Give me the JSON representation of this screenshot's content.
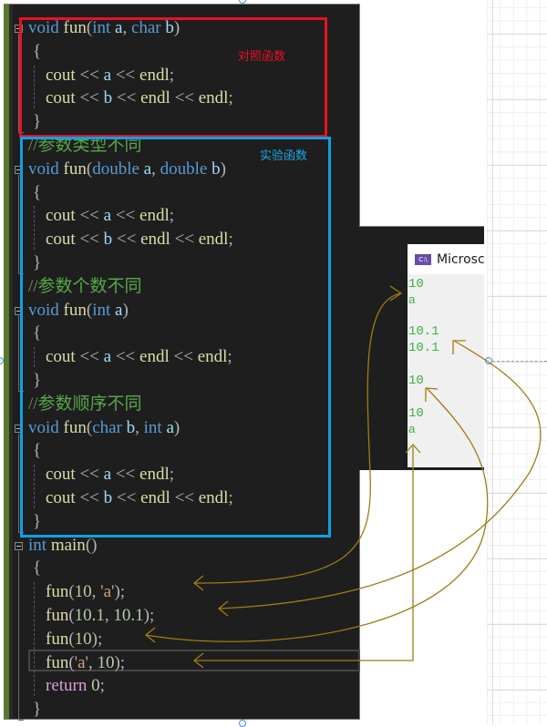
{
  "annotations": {
    "control_label": "对照函数",
    "experiment_label": "实验函数",
    "control_color": "#e81123",
    "experiment_color": "#0fa0e6",
    "arrow_color": "#a07c14"
  },
  "code": {
    "lines": [
      {
        "tokens": [
          [
            "kw",
            "void"
          ],
          [
            "",
            ""
          ],
          [
            "fn",
            "fun"
          ],
          [
            "op",
            "("
          ],
          [
            "kw",
            "int"
          ],
          [
            "id",
            " a"
          ],
          [
            "op",
            ", "
          ],
          [
            "kw",
            "char"
          ],
          [
            "id",
            " b"
          ],
          [
            "op",
            ")"
          ]
        ]
      },
      {
        "tokens": [
          [
            "op",
            "{"
          ]
        ]
      },
      {
        "tokens": [
          [
            "",
            "    "
          ],
          [
            "fn",
            "cout"
          ],
          [
            "op",
            " << "
          ],
          [
            "id",
            "a"
          ],
          [
            "op",
            " << "
          ],
          [
            "fn",
            "endl"
          ],
          [
            "op",
            ";"
          ]
        ]
      },
      {
        "tokens": [
          [
            "",
            "    "
          ],
          [
            "fn",
            "cout"
          ],
          [
            "op",
            " << "
          ],
          [
            "id",
            "b"
          ],
          [
            "op",
            " << "
          ],
          [
            "fn",
            "endl"
          ],
          [
            "op",
            " << "
          ],
          [
            "fn",
            "endl"
          ],
          [
            "op",
            ";"
          ]
        ]
      },
      {
        "tokens": [
          [
            "op",
            "}"
          ]
        ]
      },
      {
        "tokens": [
          [
            "cm",
            "//参数类型不同"
          ]
        ]
      },
      {
        "tokens": [
          [
            "kw",
            "void"
          ],
          [
            "",
            ""
          ],
          [
            "fn",
            "fun"
          ],
          [
            "op",
            "("
          ],
          [
            "kw",
            "double"
          ],
          [
            "id",
            " a"
          ],
          [
            "op",
            ", "
          ],
          [
            "kw",
            "double"
          ],
          [
            "id",
            " b"
          ],
          [
            "op",
            ")"
          ]
        ]
      },
      {
        "tokens": [
          [
            "op",
            "{"
          ]
        ]
      },
      {
        "tokens": [
          [
            "",
            "    "
          ],
          [
            "fn",
            "cout"
          ],
          [
            "op",
            " << "
          ],
          [
            "id",
            "a"
          ],
          [
            "op",
            " << "
          ],
          [
            "fn",
            "endl"
          ],
          [
            "op",
            ";"
          ]
        ]
      },
      {
        "tokens": [
          [
            "",
            "    "
          ],
          [
            "fn",
            "cout"
          ],
          [
            "op",
            " << "
          ],
          [
            "id",
            "b"
          ],
          [
            "op",
            " << "
          ],
          [
            "fn",
            "endl"
          ],
          [
            "op",
            " << "
          ],
          [
            "fn",
            "endl"
          ],
          [
            "op",
            ";"
          ]
        ]
      },
      {
        "tokens": [
          [
            "op",
            "}"
          ]
        ]
      },
      {
        "tokens": [
          [
            "cm",
            "//参数个数不同"
          ]
        ]
      },
      {
        "tokens": [
          [
            "kw",
            "void"
          ],
          [
            "",
            ""
          ],
          [
            "fn",
            "fun"
          ],
          [
            "op",
            "("
          ],
          [
            "kw",
            "int"
          ],
          [
            "id",
            " a"
          ],
          [
            "op",
            ")"
          ]
        ]
      },
      {
        "tokens": [
          [
            "op",
            "{"
          ]
        ]
      },
      {
        "tokens": [
          [
            "",
            "    "
          ],
          [
            "fn",
            "cout"
          ],
          [
            "op",
            " << "
          ],
          [
            "id",
            "a"
          ],
          [
            "op",
            " << "
          ],
          [
            "fn",
            "endl"
          ],
          [
            "op",
            " << "
          ],
          [
            "fn",
            "endl"
          ],
          [
            "op",
            ";"
          ]
        ]
      },
      {
        "tokens": [
          [
            "op",
            "}"
          ]
        ]
      },
      {
        "tokens": [
          [
            "cm",
            "//参数顺序不同"
          ]
        ]
      },
      {
        "tokens": [
          [
            "kw",
            "void"
          ],
          [
            "",
            ""
          ],
          [
            "fn",
            "fun"
          ],
          [
            "op",
            "("
          ],
          [
            "kw",
            "char"
          ],
          [
            "id",
            " b"
          ],
          [
            "op",
            ", "
          ],
          [
            "kw",
            "int"
          ],
          [
            "id",
            " a"
          ],
          [
            "op",
            ")"
          ]
        ]
      },
      {
        "tokens": [
          [
            "op",
            "{"
          ]
        ]
      },
      {
        "tokens": [
          [
            "",
            "    "
          ],
          [
            "fn",
            "cout"
          ],
          [
            "op",
            " << "
          ],
          [
            "id",
            "a"
          ],
          [
            "op",
            " << "
          ],
          [
            "fn",
            "endl"
          ],
          [
            "op",
            ";"
          ]
        ]
      },
      {
        "tokens": [
          [
            "",
            "    "
          ],
          [
            "fn",
            "cout"
          ],
          [
            "op",
            " << "
          ],
          [
            "id",
            "b"
          ],
          [
            "op",
            " << "
          ],
          [
            "fn",
            "endl"
          ],
          [
            "op",
            " << "
          ],
          [
            "fn",
            "endl"
          ],
          [
            "op",
            ";"
          ]
        ]
      },
      {
        "tokens": [
          [
            "op",
            "}"
          ]
        ]
      },
      {
        "tokens": [
          [
            "kw",
            "int"
          ],
          [
            "",
            ""
          ],
          [
            "fn",
            "main"
          ],
          [
            "op",
            "()"
          ]
        ]
      },
      {
        "tokens": [
          [
            "op",
            "{"
          ]
        ]
      },
      {
        "tokens": [
          [
            "",
            "    "
          ],
          [
            "fn",
            "fun"
          ],
          [
            "op",
            "("
          ],
          [
            "num",
            "10"
          ],
          [
            "op",
            ", "
          ],
          [
            "str",
            "'a'"
          ],
          [
            "op",
            ");"
          ]
        ]
      },
      {
        "tokens": [
          [
            "",
            "    "
          ],
          [
            "fn",
            "fun"
          ],
          [
            "op",
            "("
          ],
          [
            "num",
            "10.1"
          ],
          [
            "op",
            ", "
          ],
          [
            "num",
            "10.1"
          ],
          [
            "op",
            ");"
          ]
        ]
      },
      {
        "tokens": [
          [
            "",
            "    "
          ],
          [
            "fn",
            "fun"
          ],
          [
            "op",
            "("
          ],
          [
            "num",
            "10"
          ],
          [
            "op",
            ");"
          ]
        ]
      },
      {
        "tokens": [
          [
            "",
            "    "
          ],
          [
            "fn",
            "fun"
          ],
          [
            "op",
            "("
          ],
          [
            "str",
            "'a'"
          ],
          [
            "op",
            ", "
          ],
          [
            "num",
            "10"
          ],
          [
            "op",
            ");"
          ]
        ]
      },
      {
        "tokens": [
          [
            "",
            "    "
          ],
          [
            "ret",
            "return"
          ],
          [
            "op",
            " "
          ],
          [
            "num",
            "0"
          ],
          [
            "op",
            ";"
          ]
        ]
      },
      {
        "tokens": [
          [
            "op",
            "}"
          ]
        ]
      }
    ]
  },
  "console": {
    "title": "Microsoft Visual Studio 调试控制台",
    "title_visible": "Microsc",
    "icon": "C:\\",
    "output": [
      "10",
      "a",
      "",
      "10.1",
      "10.1",
      "",
      "10",
      "",
      "10",
      "a"
    ]
  }
}
